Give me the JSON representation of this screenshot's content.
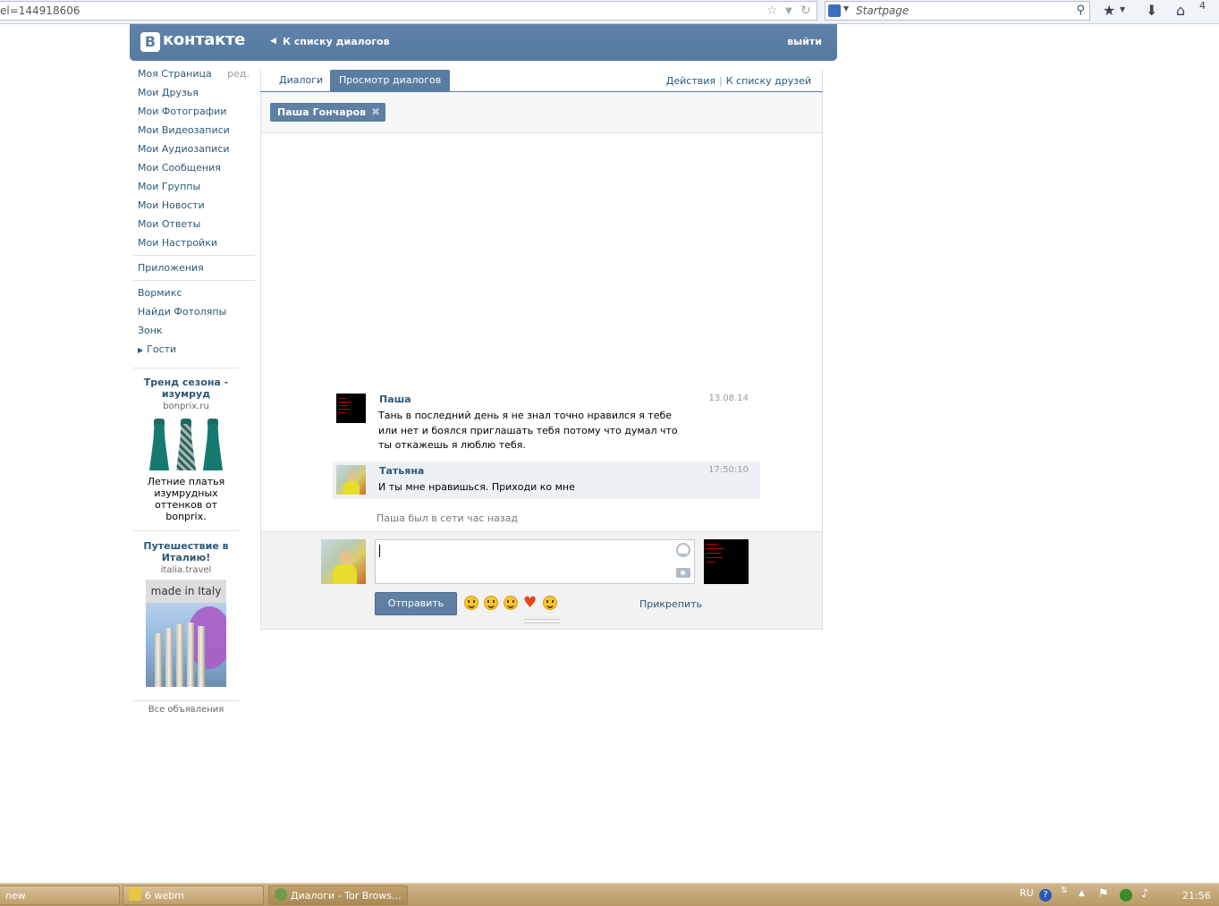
{
  "browser": {
    "url": "el=144918606",
    "search_placeholder": "Startpage",
    "tab_count": "4"
  },
  "header": {
    "logo_b": "В",
    "logo_text": "контакте",
    "back_link": "К списку диалогов",
    "logout": "выйти"
  },
  "sidebar": {
    "edit_label": "ред.",
    "items_main": [
      "Моя Страница",
      "Мои Друзья",
      "Мои Фотографии",
      "Мои Видеозаписи",
      "Мои Аудиозаписи",
      "Мои Сообщения",
      "Мои Группы",
      "Мои Новости",
      "Мои Ответы",
      "Мои Настройки"
    ],
    "apps": "Приложения",
    "items_apps": [
      "Вормикс",
      "Найди Фотоляпы",
      "Зонк",
      "Гости"
    ]
  },
  "ads": [
    {
      "title": "Тренд сезона - изумруд",
      "domain": "bonprix.ru",
      "text": "Летние платья изумрудных оттенков от bonprix."
    },
    {
      "title": "Путешествие в Италию!",
      "domain": "italia.travel",
      "banner": "made in Italy"
    }
  ],
  "ads_all": "Все объявления",
  "tabs": {
    "dialogs": "Диалоги",
    "view": "Просмотр диалогов",
    "actions": "Действия",
    "friends": "К списку друзей"
  },
  "peer": {
    "name": "Паша Гончаров"
  },
  "messages": [
    {
      "author": "Паша",
      "date": "13.08.14",
      "text": "Тань в последний день я не знал точно нравился я тебе или нет и боялся приглашать тебя потому что думал что ты откажешь я люблю тебя."
    },
    {
      "author": "Татьяна",
      "date": "17:50:10",
      "text": "И ты мне нравишься. Приходи ко мне"
    }
  ],
  "online_status": "Паша был в сети час назад",
  "composer": {
    "send": "Отправить",
    "attach": "Прикрепить"
  },
  "taskbar": {
    "items": [
      "new",
      "6 webm",
      "Диалоги - Tor Brows..."
    ],
    "lang": "RU",
    "time": "21:56"
  },
  "colors": {
    "vk_blue": "#5b7ea3",
    "link": "#2b587a",
    "taskbar": "#c3a677"
  }
}
